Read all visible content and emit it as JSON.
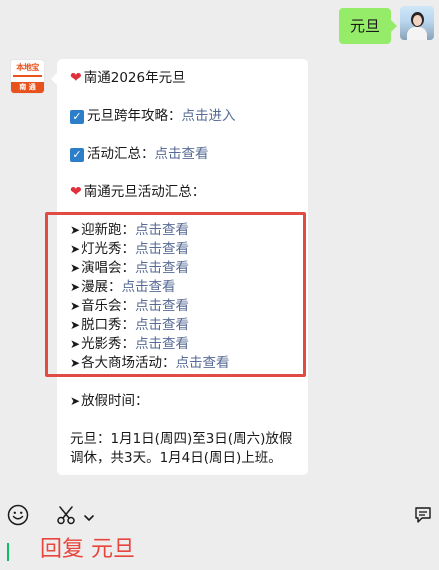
{
  "outgoing": {
    "text": "元旦"
  },
  "incoming": {
    "sender_logo": {
      "top": "本地宝",
      "bottom": "南 通"
    },
    "title": "南通2026年元旦",
    "guide_label": "元旦跨年攻略：",
    "guide_link": "点击进入",
    "summary_label": "活动汇总：",
    "summary_link": "点击查看",
    "events_heading": "南通元旦活动汇总：",
    "events": [
      {
        "name": "迎新跑：",
        "link": "点击查看"
      },
      {
        "name": "灯光秀：",
        "link": "点击查看"
      },
      {
        "name": "演唱会：",
        "link": "点击查看"
      },
      {
        "name": "漫展：",
        "link": "点击查看"
      },
      {
        "name": "音乐会：",
        "link": "点击查看"
      },
      {
        "name": "脱口秀：",
        "link": "点击查看"
      },
      {
        "name": "光影秀：",
        "link": "点击查看"
      },
      {
        "name": "各大商场活动：",
        "link": "点击查看"
      }
    ],
    "arrow_glyph": "➤",
    "holiday_label": "放假时间：",
    "holiday_line1": "元旦：1月1日(周四)至3日(周六)放假",
    "holiday_line2": "调休，共3天。1月4日(周日)上班。"
  },
  "composer": {
    "typed_text": "回复 元旦"
  },
  "colors": {
    "background": "#ededed",
    "outgoing_bubble": "#95ec69",
    "link": "#576b95",
    "highlight": "#e04b45",
    "reply_text": "#e8453c",
    "brand_orange": "#e8531d"
  },
  "icons": {
    "emoji": "emoji-icon",
    "scissors": "scissors-icon",
    "chevron": "chevron-down-icon",
    "notes": "notes-icon",
    "heart": "heart-icon",
    "check": "checkbox-icon"
  }
}
